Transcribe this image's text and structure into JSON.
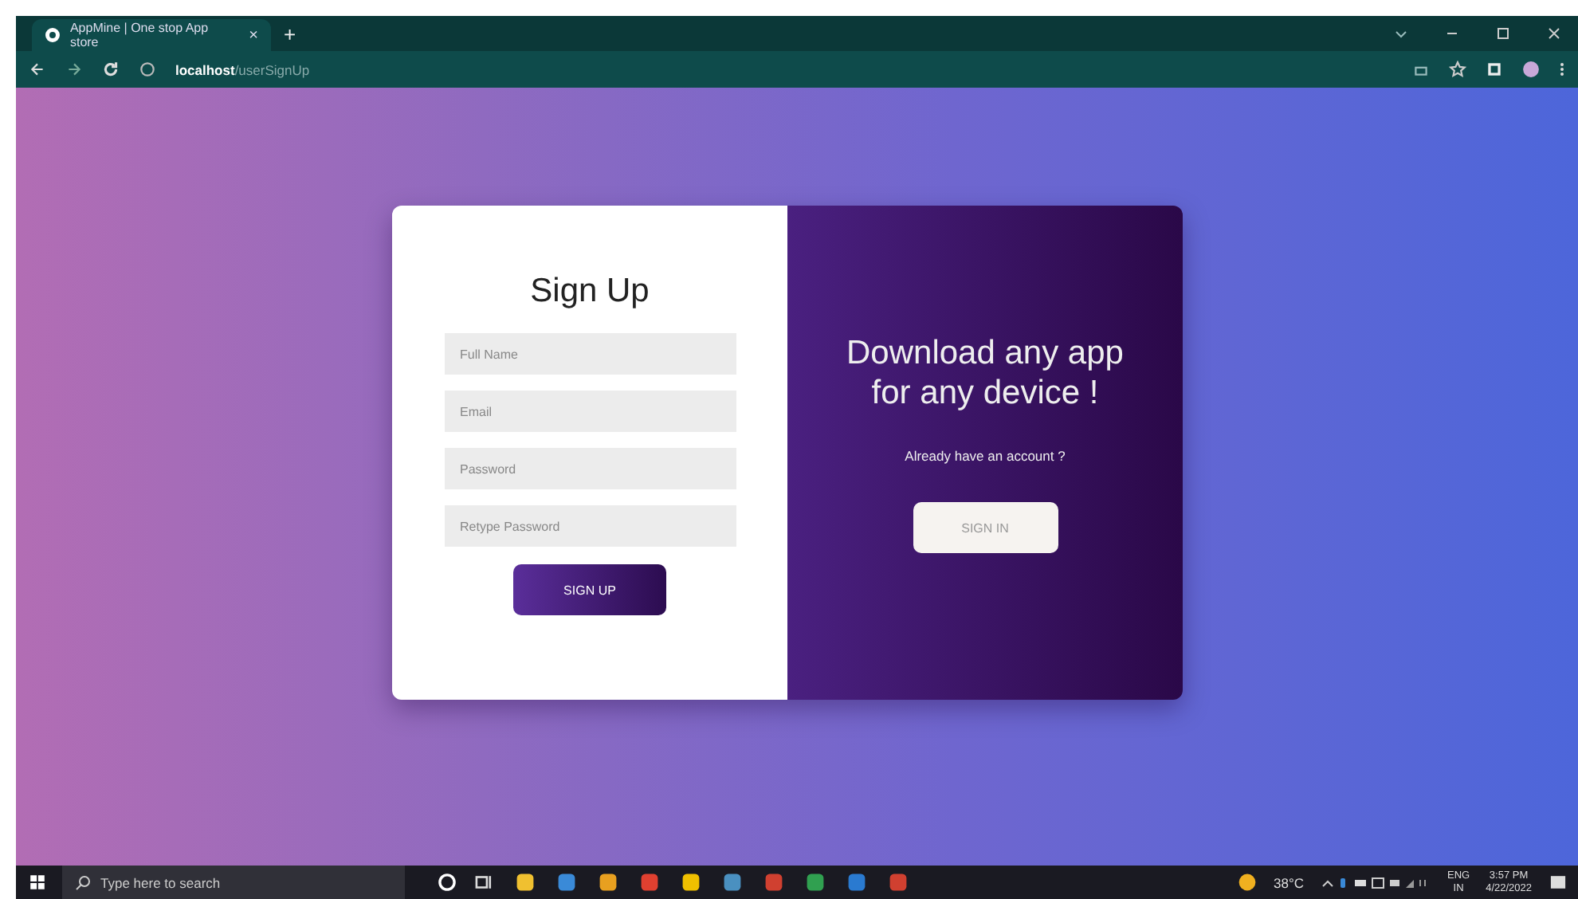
{
  "browser": {
    "tab_title": "AppMine | One stop App store",
    "tab_close": "×",
    "new_tab": "+",
    "url_host": "localhost",
    "url_path": "/userSignUp"
  },
  "signup": {
    "title": "Sign Up",
    "fields": [
      {
        "placeholder": "Full Name"
      },
      {
        "placeholder": "Email"
      },
      {
        "placeholder": "Password"
      },
      {
        "placeholder": "Retype Password"
      }
    ],
    "button": "SIGN UP"
  },
  "promo": {
    "heading": "Download any app for any device !",
    "prompt": "Already have an account ?",
    "button": "SIGN IN"
  },
  "taskbar": {
    "search_placeholder": "Type here to search",
    "temperature": "38°C",
    "language": "ENG",
    "region": "IN",
    "time": "3:57 PM",
    "date": "4/22/2022"
  }
}
